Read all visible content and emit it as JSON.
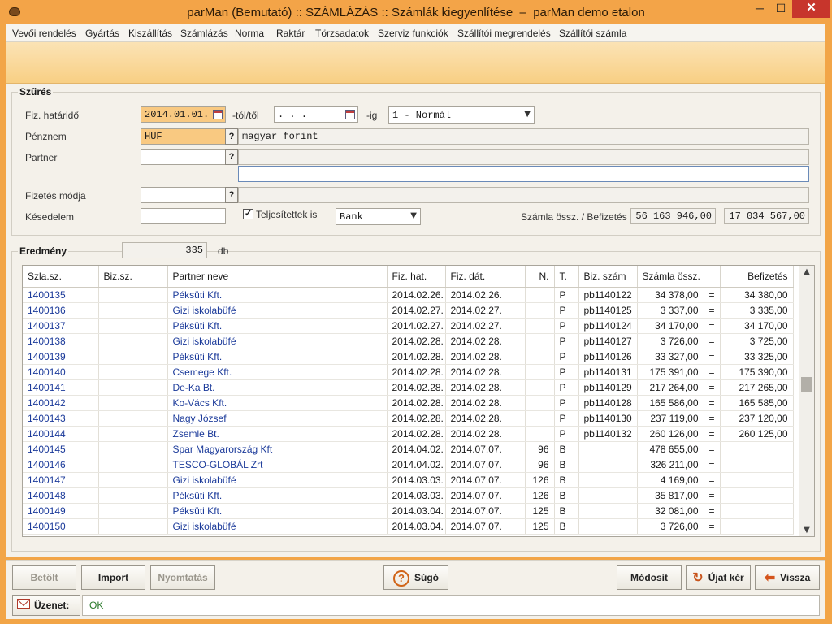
{
  "window": {
    "title": "parMan (Bemutató) :: SZÁMLÁZÁS :: Számlák kiegyenlítése  –  parMan demo etalon",
    "minimize": "─",
    "maximize": "☐",
    "close": "✕"
  },
  "menu": [
    "Vevői rendelés",
    "Gyártás",
    "Kiszállítás",
    "Számlázás",
    "Norma",
    "Raktár",
    "Törzsadatok",
    "Szerviz funkciók",
    "Szállítói megrendelés",
    "Szállítói számla"
  ],
  "filter": {
    "title": "Szűrés",
    "due_label": "Fiz. határidő",
    "due_from": "2014.01.01.",
    "from_suffix": "-tól/től",
    "due_to": " .  .  .",
    "to_suffix": "-ig",
    "type_select": "1 - Normál",
    "currency_label": "Pénznem",
    "currency_code": "HUF",
    "currency_name": "magyar forint",
    "partner_label": "Partner",
    "partner_value": "",
    "payment_label": "Fizetés módja",
    "payment_value": "",
    "delay_label": "Késedelem",
    "delay_value": "",
    "completed_label": "Teljesítettek is",
    "completed_checked": "✓",
    "method_select": "Bank",
    "totals_label": "Számla össz. / Befizetés",
    "invoice_total": "56 163 946,00",
    "payment_total": "17 034 567,00",
    "question_mark": "?"
  },
  "result": {
    "title": "Eredmény",
    "count": "335",
    "unit": "db"
  },
  "table": {
    "columns": [
      "Szla.sz.",
      "Biz.sz.",
      "Partner neve",
      "Fiz. hat.",
      "Fiz. dát.",
      "N.",
      "T.",
      "Biz. szám",
      "Számla össz.",
      "",
      "Befizetés"
    ],
    "rows": [
      [
        "1400135",
        "",
        "Péksüti Kft.",
        "2014.02.26.",
        "2014.02.26.",
        "",
        "P",
        "pb1140122",
        "34 378,00",
        "=",
        "34 380,00"
      ],
      [
        "1400136",
        "",
        "Gizi iskolabüfé",
        "2014.02.27.",
        "2014.02.27.",
        "",
        "P",
        "pb1140125",
        "3 337,00",
        "=",
        "3 335,00"
      ],
      [
        "1400137",
        "",
        "Péksüti Kft.",
        "2014.02.27.",
        "2014.02.27.",
        "",
        "P",
        "pb1140124",
        "34 170,00",
        "=",
        "34 170,00"
      ],
      [
        "1400138",
        "",
        "Gizi iskolabüfé",
        "2014.02.28.",
        "2014.02.28.",
        "",
        "P",
        "pb1140127",
        "3 726,00",
        "=",
        "3 725,00"
      ],
      [
        "1400139",
        "",
        "Péksüti Kft.",
        "2014.02.28.",
        "2014.02.28.",
        "",
        "P",
        "pb1140126",
        "33 327,00",
        "=",
        "33 325,00"
      ],
      [
        "1400140",
        "",
        "Csemege Kft.",
        "2014.02.28.",
        "2014.02.28.",
        "",
        "P",
        "pb1140131",
        "175 391,00",
        "=",
        "175 390,00"
      ],
      [
        "1400141",
        "",
        "De-Ka Bt.",
        "2014.02.28.",
        "2014.02.28.",
        "",
        "P",
        "pb1140129",
        "217 264,00",
        "=",
        "217 265,00"
      ],
      [
        "1400142",
        "",
        "Ko-Vács Kft.",
        "2014.02.28.",
        "2014.02.28.",
        "",
        "P",
        "pb1140128",
        "165 586,00",
        "=",
        "165 585,00"
      ],
      [
        "1400143",
        "",
        "Nagy József",
        "2014.02.28.",
        "2014.02.28.",
        "",
        "P",
        "pb1140130",
        "237 119,00",
        "=",
        "237 120,00"
      ],
      [
        "1400144",
        "",
        "Zsemle Bt.",
        "2014.02.28.",
        "2014.02.28.",
        "",
        "P",
        "pb1140132",
        "260 126,00",
        "=",
        "260 125,00"
      ],
      [
        "1400145",
        "",
        "Spar Magyarország Kft",
        "2014.04.02.",
        "2014.07.07.",
        "96",
        "B",
        "",
        "478 655,00",
        "=",
        ""
      ],
      [
        "1400146",
        "",
        "TESCO-GLOBÁL Zrt",
        "2014.04.02.",
        "2014.07.07.",
        "96",
        "B",
        "",
        "326 211,00",
        "=",
        ""
      ],
      [
        "1400147",
        "",
        "Gizi iskolabüfé",
        "2014.03.03.",
        "2014.07.07.",
        "126",
        "B",
        "",
        "4 169,00",
        "=",
        ""
      ],
      [
        "1400148",
        "",
        "Péksüti Kft.",
        "2014.03.03.",
        "2014.07.07.",
        "126",
        "B",
        "",
        "35 817,00",
        "=",
        ""
      ],
      [
        "1400149",
        "",
        "Péksüti Kft.",
        "2014.03.04.",
        "2014.07.07.",
        "125",
        "B",
        "",
        "32 081,00",
        "=",
        ""
      ],
      [
        "1400150",
        "",
        "Gizi iskolabüfé",
        "2014.03.04.",
        "2014.07.07.",
        "125",
        "B",
        "",
        "3 726,00",
        "=",
        ""
      ]
    ]
  },
  "buttons": {
    "load": "Betölt",
    "import": "Import",
    "print": "Nyomtatás",
    "help": "Súgó",
    "modify": "Módosít",
    "new_request": "Újat kér",
    "back": "Vissza"
  },
  "status": {
    "label": "Üzenet:",
    "message": "OK"
  }
}
